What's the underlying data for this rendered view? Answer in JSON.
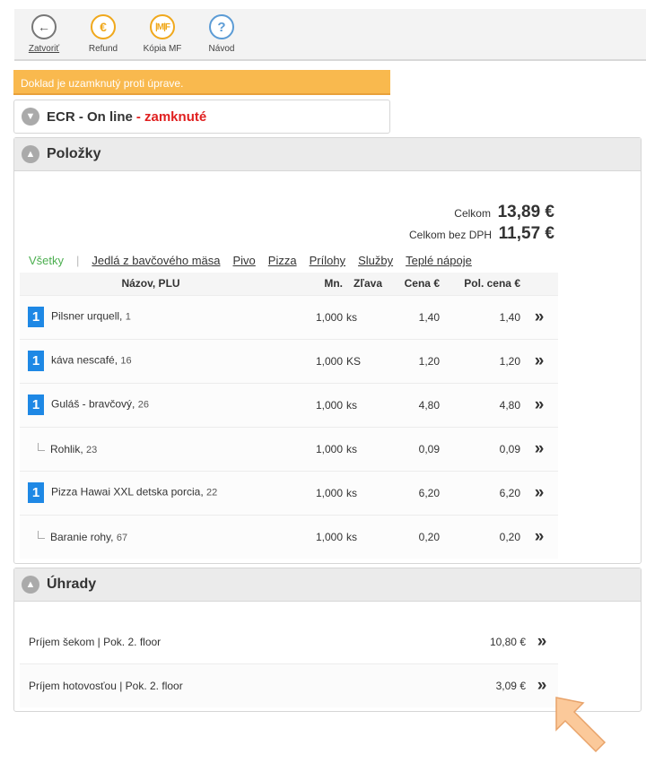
{
  "toolbar": {
    "buttons": [
      {
        "label": "Zatvoriť",
        "icon": "back-arrow-icon"
      },
      {
        "label": "Refund",
        "icon": "euro-icon"
      },
      {
        "label": "Kópia MF",
        "icon": "copy-mf-icon"
      },
      {
        "label": "Návod",
        "icon": "help-icon"
      }
    ]
  },
  "warning": "Doklad je uzamknutý proti úprave.",
  "ecr": {
    "title": "ECR - On line",
    "locked": "- zamknuté"
  },
  "items_panel": {
    "title": "Položky",
    "total_label": "Celkom",
    "total_value": "13,89 €",
    "net_label": "Celkom bez DPH",
    "net_value": "11,57 €",
    "filters": [
      "Všetky",
      "Jedlá z bavčového mäsa",
      "Pivo",
      "Pizza",
      "Prílohy",
      "Služby",
      "Teplé nápoje"
    ],
    "columns": {
      "name": "Názov, PLU",
      "qty": "Mn.",
      "discount": "Zľava",
      "price": "Cena €",
      "line_total": "Pol. cena €"
    },
    "rows": [
      {
        "badge": "1",
        "name": "Pilsner urquell",
        "plu": "1",
        "qty": "1,000",
        "unit": "ks",
        "price": "1,40",
        "total": "1,40"
      },
      {
        "badge": "1",
        "name": "káva nescafé",
        "plu": "16",
        "qty": "1,000",
        "unit": "KS",
        "price": "1,20",
        "total": "1,20"
      },
      {
        "badge": "1",
        "name": "Guláš - bravčový",
        "plu": "26",
        "qty": "1,000",
        "unit": "ks",
        "price": "4,80",
        "total": "4,80"
      },
      {
        "badge": "",
        "name": "Rohlik",
        "plu": "23",
        "qty": "1,000",
        "unit": "ks",
        "price": "0,09",
        "total": "0,09"
      },
      {
        "badge": "1",
        "name": "Pizza Hawai XXL detska porcia",
        "plu": "22",
        "qty": "1,000",
        "unit": "ks",
        "price": "6,20",
        "total": "6,20"
      },
      {
        "badge": "",
        "name": "Baranie rohy",
        "plu": "67",
        "qty": "1,000",
        "unit": "ks",
        "price": "0,20",
        "total": "0,20"
      }
    ],
    "arrow": "»"
  },
  "payments_panel": {
    "title": "Úhrady",
    "rows": [
      {
        "label": "Príjem šekom | Pok. 2. floor",
        "amount": "10,80 €"
      },
      {
        "label": "Príjem hotovosťou | Pok. 2. floor",
        "amount": "3,09 €"
      }
    ]
  },
  "colors": {
    "warning": "#f9b94e",
    "badge": "#1e88e5",
    "locked": "#e02020",
    "filter_active": "#4caf50",
    "pointer": "#fbc99a"
  }
}
